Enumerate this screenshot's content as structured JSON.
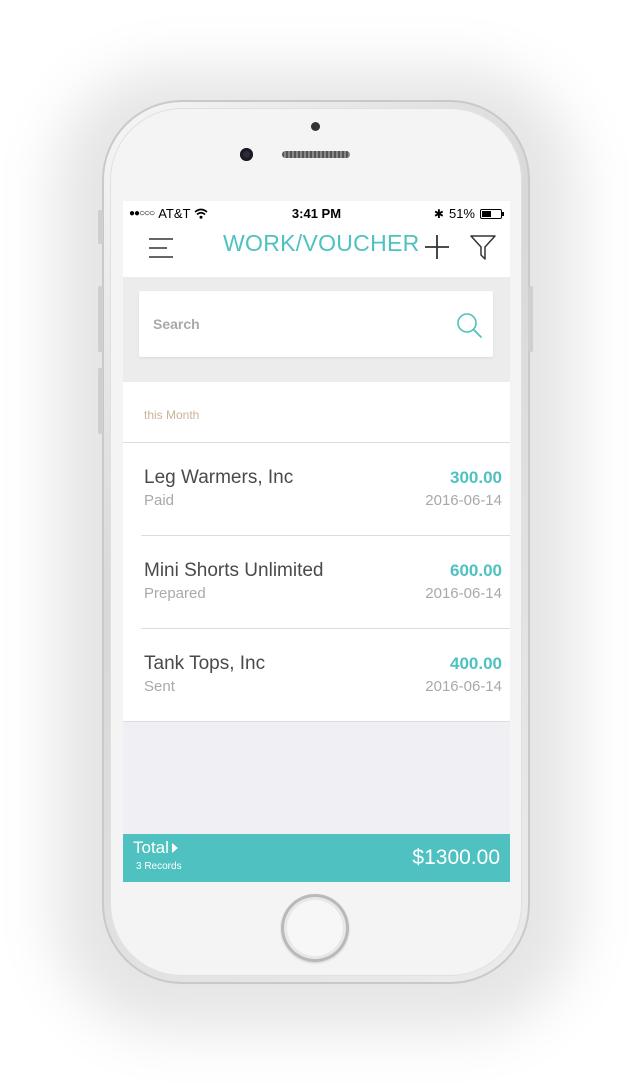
{
  "status_bar": {
    "carrier": "AT&T",
    "signal": "●●○○○",
    "time": "3:41 PM",
    "bluetooth": "✱",
    "battery_percent_label": "51%",
    "battery_level": 0.51
  },
  "nav": {
    "title": "WORK/VOUCHER",
    "menu_icon": "hamburger-menu-icon",
    "add_icon": "plus-icon",
    "filter_icon": "funnel-filter-icon"
  },
  "search": {
    "placeholder": "Search",
    "value": "",
    "icon": "search-icon"
  },
  "section": {
    "header": "this Month"
  },
  "items": [
    {
      "name": "Leg Warmers, Inc",
      "status": "Paid",
      "amount": "300.00",
      "date": "2016-06-14"
    },
    {
      "name": "Mini Shorts Unlimited",
      "status": "Prepared",
      "amount": "600.00",
      "date": "2016-06-14"
    },
    {
      "name": "Tank Tops, Inc",
      "status": "Sent",
      "amount": "400.00",
      "date": "2016-06-14"
    }
  ],
  "total": {
    "label": "Total",
    "records": "3 Records",
    "amount": "$1300.00"
  },
  "colors": {
    "accent": "#4fc1c1",
    "section_header": "#c8b49a",
    "muted_text": "#a9a9a9",
    "primary_text": "#4a4a4a",
    "screen_bg": "#efeff4"
  }
}
